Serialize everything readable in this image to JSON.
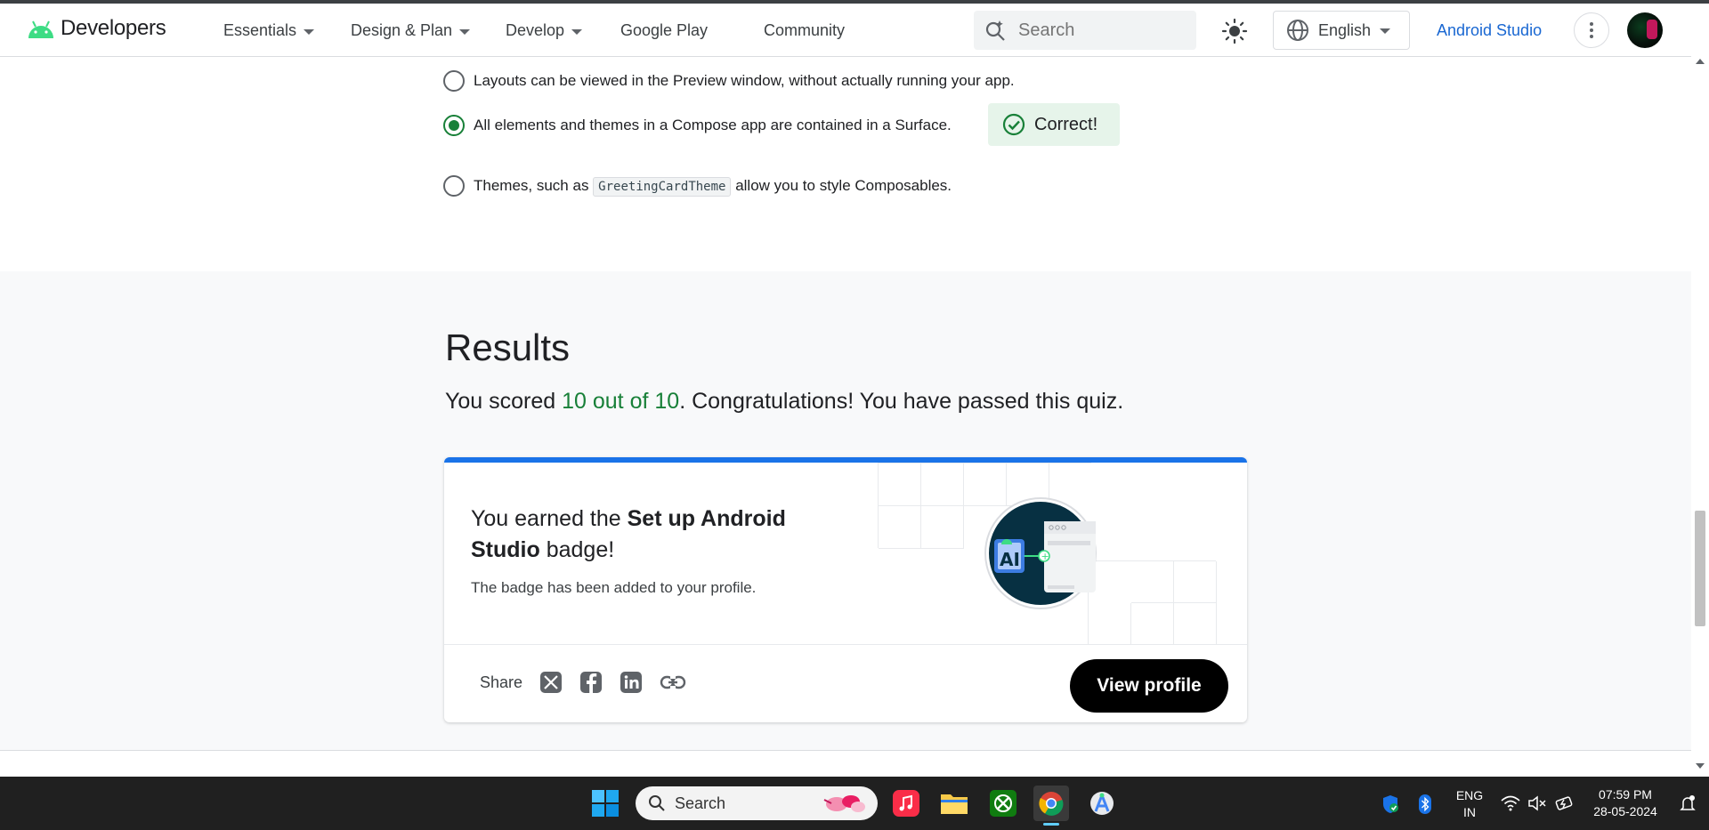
{
  "header": {
    "logo_text": "Developers",
    "nav": [
      {
        "label": "Essentials",
        "dropdown": true
      },
      {
        "label": "Design & Plan",
        "dropdown": true
      },
      {
        "label": "Develop",
        "dropdown": true
      },
      {
        "label": "Google Play",
        "dropdown": false
      },
      {
        "label": "Community",
        "dropdown": false
      }
    ],
    "search_placeholder": "Search",
    "language": "English",
    "studio_link": "Android Studio"
  },
  "quiz": {
    "options": [
      {
        "text": "Layouts can be viewed in the Preview window, without actually running your app.",
        "selected": false
      },
      {
        "text": "All elements and themes in a Compose app are contained in a Surface.",
        "selected": true
      },
      {
        "text_before": "Themes, such as ",
        "code": "GreetingCardTheme",
        "text_after": " allow you to style Composables.",
        "selected": false
      }
    ],
    "feedback": "Correct!"
  },
  "results": {
    "title": "Results",
    "score_prefix": "You scored ",
    "score": "10 out of 10",
    "score_suffix": ". Congratulations! You have passed this quiz.",
    "badge": {
      "earned_prefix": "You earned the ",
      "badge_name": "Set up Android Studio",
      "earned_suffix": " badge!",
      "added_text": "The badge has been added to your profile.",
      "share_label": "Share",
      "share_icons": [
        "x-icon",
        "facebook-icon",
        "linkedin-icon",
        "link-icon"
      ],
      "view_profile": "View profile"
    }
  },
  "taskbar": {
    "search_placeholder": "Search",
    "apps": [
      "windows-start-icon",
      "apple-music-icon",
      "file-explorer-icon",
      "xbox-icon",
      "chrome-icon",
      "android-studio-icon"
    ],
    "lang_line1": "ENG",
    "lang_line2": "IN",
    "time": "07:59 PM",
    "date": "28-05-2024"
  },
  "colors": {
    "accent_blue": "#1a73e8",
    "correct_green": "#188038",
    "correct_bg": "#e6f4ea",
    "results_bg": "#f8f9fa"
  }
}
